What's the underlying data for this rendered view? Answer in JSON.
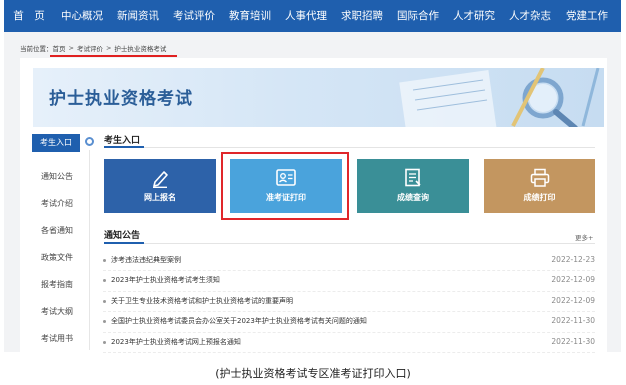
{
  "nav": {
    "items": [
      "首　页",
      "中心概况",
      "新闻资讯",
      "考试评价",
      "教育培训",
      "人事代理",
      "求职招聘",
      "国际合作",
      "人才研究",
      "人才杂志",
      "党建工作"
    ]
  },
  "breadcrumb": {
    "prefix": "当前位置：",
    "items": [
      "首页",
      "考试评价",
      "护士执业资格考试"
    ],
    "separator": ">"
  },
  "banner": {
    "title": "护士执业资格考试"
  },
  "sidebar": {
    "items": [
      "考生入口",
      "通知公告",
      "考试介绍",
      "各省通知",
      "政策文件",
      "报考指南",
      "考试大纲",
      "考试用书"
    ],
    "active_index": 0
  },
  "entry": {
    "title": "考生入口",
    "tiles": [
      {
        "label": "网上报名",
        "icon": "pencil-icon",
        "color": "#2d62a9"
      },
      {
        "label": "准考证打印",
        "icon": "id-card-icon",
        "color": "#4aa3dc"
      },
      {
        "label": "成绩查询",
        "icon": "document-icon",
        "color": "#3a8f97"
      },
      {
        "label": "成绩打印",
        "icon": "printer-icon",
        "color": "#c39660"
      }
    ]
  },
  "notices": {
    "title": "通知公告",
    "more_label": "更多+",
    "items": [
      {
        "text": "涉考违法违纪典型案例",
        "date": "2022-12-23"
      },
      {
        "text": "2023年护士执业资格考试考生须知",
        "date": "2022-12-09"
      },
      {
        "text": "关于卫生专业技术资格考试和护士执业资格考试的重要声明",
        "date": "2022-12-09"
      },
      {
        "text": "全国护士执业资格考试委员会办公室关于2023年护士执业资格考试有关问题的通知",
        "date": "2022-11-30"
      },
      {
        "text": "2023年护士执业资格考试网上预报名通知",
        "date": "2022-11-30"
      }
    ]
  },
  "caption": "(护士执业资格考试专区准考证打印入口)",
  "colors": {
    "nav": "#1f5fae",
    "highlight": "#e0262a"
  }
}
